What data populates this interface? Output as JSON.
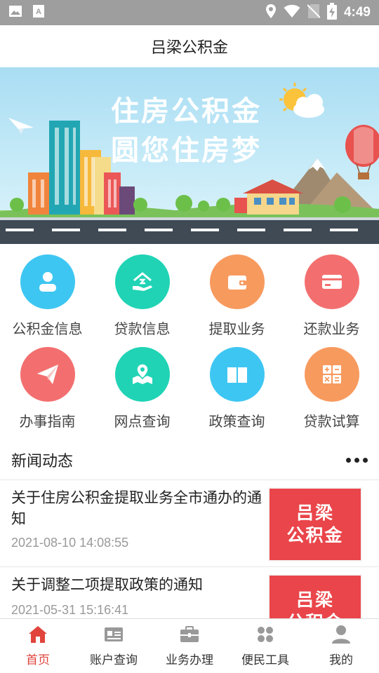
{
  "status_bar": {
    "time": "4:49"
  },
  "header": {
    "title": "吕梁公积金"
  },
  "banner": {
    "line1": "住房公积金",
    "line2": "圆您住房梦"
  },
  "grid": {
    "items": [
      {
        "label": "公积金信息",
        "icon": "person-icon",
        "color": "#3ec6f2"
      },
      {
        "label": "贷款信息",
        "icon": "house-hand-icon",
        "color": "#20d3b5"
      },
      {
        "label": "提取业务",
        "icon": "wallet-icon",
        "color": "#f79a5e"
      },
      {
        "label": "还款业务",
        "icon": "card-icon",
        "color": "#f36f6f"
      },
      {
        "label": "办事指南",
        "icon": "paper-plane-icon",
        "color": "#f36f6f"
      },
      {
        "label": "网点查询",
        "icon": "map-pin-icon",
        "color": "#20d3b5"
      },
      {
        "label": "政策查询",
        "icon": "book-icon",
        "color": "#3ec6f2"
      },
      {
        "label": "贷款试算",
        "icon": "calculator-icon",
        "color": "#f79a5e"
      }
    ]
  },
  "news": {
    "title": "新闻动态",
    "items": [
      {
        "title": "关于住房公积金提取业务全市通办的通知",
        "date": "2021-08-10 14:08:55",
        "thumb_line1": "吕梁",
        "thumb_line2": "公积金"
      },
      {
        "title": "关于调整二项提取政策的通知",
        "date": "2021-05-31 15:16:41",
        "thumb_line1": "吕梁",
        "thumb_line2": "公积金"
      }
    ]
  },
  "bottom_nav": {
    "items": [
      {
        "label": "首页",
        "icon": "home-icon",
        "active": true
      },
      {
        "label": "账户查询",
        "icon": "id-card-icon",
        "active": false
      },
      {
        "label": "业务办理",
        "icon": "briefcase-icon",
        "active": false
      },
      {
        "label": "便民工具",
        "icon": "apps-icon",
        "active": false
      },
      {
        "label": "我的",
        "icon": "user-icon",
        "active": false
      }
    ]
  },
  "colors": {
    "accent": "#e0443c",
    "thumb_bg": "#e9454a"
  }
}
